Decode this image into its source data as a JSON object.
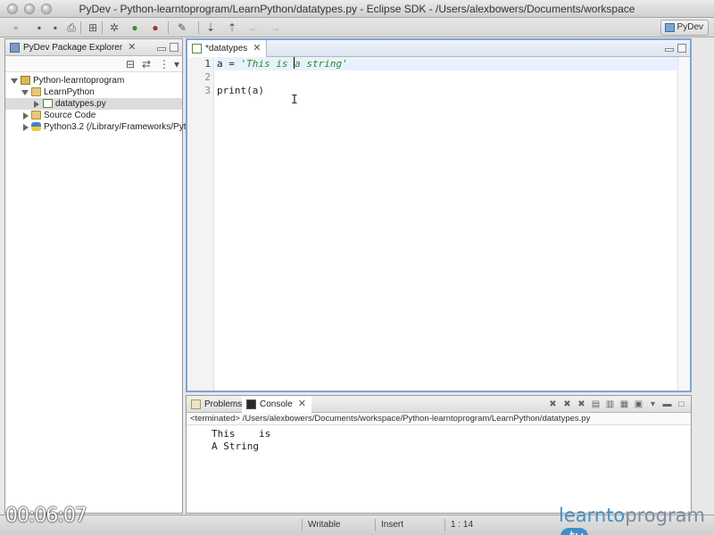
{
  "window": {
    "title": "PyDev - Python-learntoprogram/LearnPython/datatypes.py - Eclipse SDK - /Users/alexbowers/Documents/workspace"
  },
  "toolbar": {
    "perspective_label": "PyDev"
  },
  "explorer": {
    "tab_label": "PyDev Package Explorer",
    "tree": [
      {
        "label": "Python-learntoprogram"
      },
      {
        "label": "LearnPython"
      },
      {
        "label": "datatypes.py"
      },
      {
        "label": "Source Code"
      },
      {
        "label": "Python3.2  (/Library/Frameworks/Pyt"
      }
    ]
  },
  "editor": {
    "tab_label": "*datatypes",
    "line_numbers": [
      "1",
      "2",
      "3"
    ],
    "line1": {
      "var": "a",
      "op": " = ",
      "str_before_caret": "'This is ",
      "str_after_caret": "a string'"
    },
    "line3": "print(a)"
  },
  "bottom": {
    "tabs": {
      "problems": "Problems",
      "console": "Console"
    },
    "terminated": "<terminated> /Users/alexbowers/Documents/workspace/Python-learntoprogram/LearnPython/datatypes.py",
    "output": [
      "This    is",
      "A String"
    ]
  },
  "status": {
    "writable": "Writable",
    "insert": "Insert",
    "position": "1 : 14"
  },
  "overlay": {
    "timecode": "00:06:07",
    "brand_a": "learnto",
    "brand_b": "program",
    "brand_tv": ".tv"
  }
}
